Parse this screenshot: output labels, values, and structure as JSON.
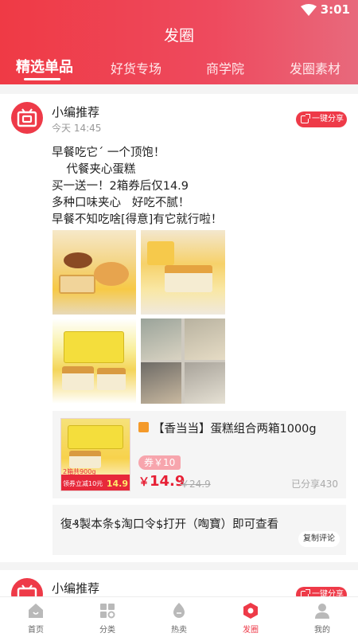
{
  "status": {
    "time": "3:01"
  },
  "header": {
    "title": "发圈",
    "tabs": [
      {
        "label": "精选单品",
        "active": true
      },
      {
        "label": "好货专场",
        "active": false
      },
      {
        "label": "商学院",
        "active": false
      },
      {
        "label": "发圈素材",
        "active": false
      }
    ]
  },
  "posts": [
    {
      "author": "小编推荐",
      "time": "今天 14:45",
      "share_label": "一键分享",
      "text": [
        "早餐吃它ˊ 一个顶饱！",
        "    代餐夹心蛋糕",
        "买一送一！2箱券后仅14.9",
        "多种口味夹心   好吃不腻！",
        "早餐不知吃啥[得意]有它就行啦！"
      ],
      "product": {
        "title": "【香当当】蛋糕组合两箱1000g",
        "coupon": "券￥10",
        "price_symbol": "￥",
        "price": "14.9",
        "original_price": "￥24.9",
        "shared": "已分享430",
        "thumb_promo_top": "2箱共900g",
        "thumb_promo": "领券立减10元",
        "thumb_price": "14.9"
      },
      "comment": {
        "text": "復₰製本条$淘口令$打开（啕寶）即可查看",
        "copy_label": "复制评论"
      }
    },
    {
      "author": "小编推荐",
      "share_label": "一键分享"
    }
  ],
  "nav": [
    {
      "label": "首页",
      "icon": "home-icon",
      "active": false
    },
    {
      "label": "分类",
      "icon": "category-icon",
      "active": false
    },
    {
      "label": "热卖",
      "icon": "hot-sale-icon",
      "active": false
    },
    {
      "label": "发圈",
      "icon": "moments-icon",
      "active": true
    },
    {
      "label": "我的",
      "icon": "profile-icon",
      "active": false
    }
  ],
  "colors": {
    "accent": "#ee3a48",
    "price": "#e72035"
  }
}
